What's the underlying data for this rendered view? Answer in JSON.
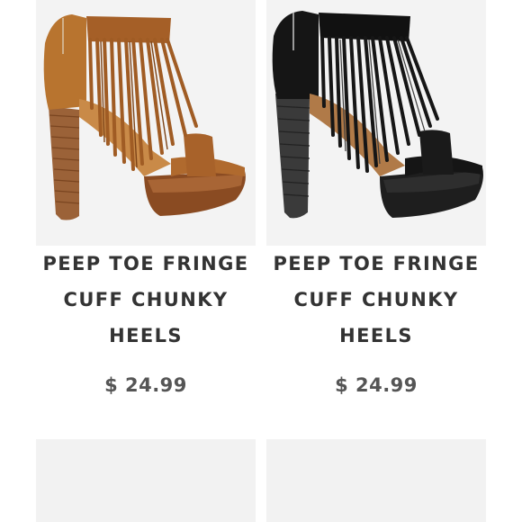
{
  "products": [
    {
      "title_lines": [
        "PEEP TOE FRINGE",
        "CUFF CHUNKY",
        "HEELS"
      ],
      "price": "$ 24.99",
      "color": "#b06a2e"
    },
    {
      "title_lines": [
        "PEEP TOE FRINGE",
        "CUFF CHUNKY",
        "HEELS"
      ],
      "price": "$ 24.99",
      "color": "#151515"
    }
  ],
  "placeholders": [
    "product-card-3",
    "product-card-4"
  ]
}
